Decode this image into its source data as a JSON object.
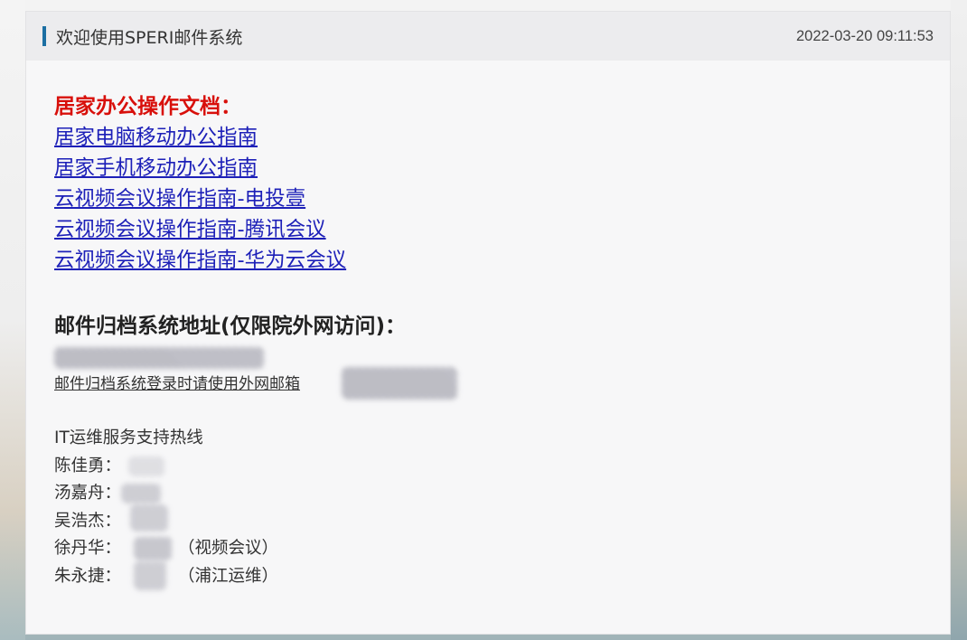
{
  "header": {
    "title": "欢迎使用SPERI邮件系统",
    "datetime": "2022-03-20 09:11:53"
  },
  "home_office": {
    "heading": "居家办公操作文档：",
    "links": [
      "居家电脑移动办公指南",
      "居家手机移动办公指南",
      "云视频会议操作指南-电投壹",
      "云视频会议操作指南-腾讯会议",
      "云视频会议操作指南-华为云会议"
    ]
  },
  "archive": {
    "heading": "邮件归档系统地址(仅限院外网访问)：",
    "login_note": "邮件归档系统登录时请使用外网邮箱"
  },
  "support": {
    "title": "IT运维服务支持热线",
    "contacts": [
      {
        "name": "陈佳勇：",
        "note": ""
      },
      {
        "name": "汤嘉舟：",
        "note": ""
      },
      {
        "name": "吴浩杰：",
        "note": ""
      },
      {
        "name": "徐丹华：",
        "note": "（视频会议）"
      },
      {
        "name": "朱永捷：",
        "note": "（浦江运维）"
      }
    ]
  },
  "colors": {
    "accent": "#1c6fa3",
    "heading_red": "#d8100b",
    "link_blue": "#1d20b8"
  }
}
